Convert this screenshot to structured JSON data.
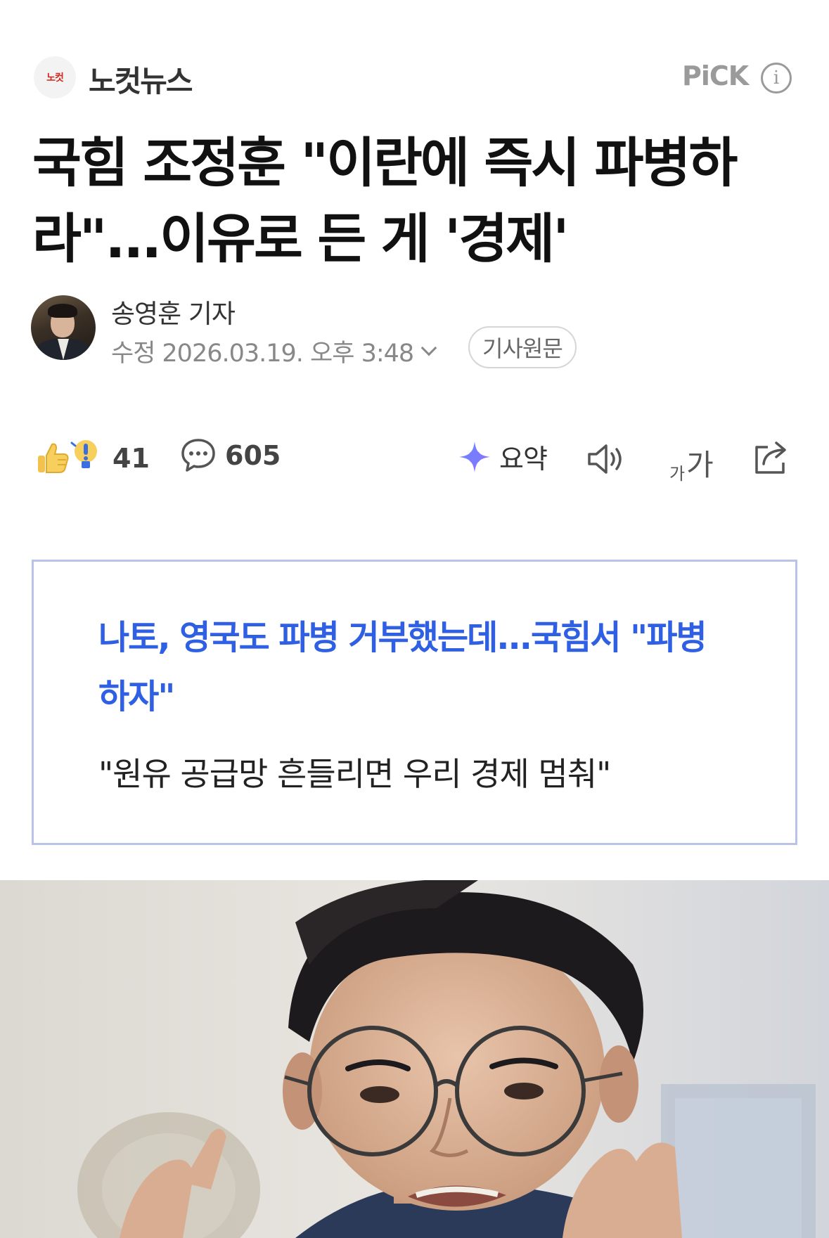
{
  "header": {
    "press_logo_text": "노컷",
    "press_name": "노컷뉴스",
    "pick_label": "PiCK",
    "info_icon": "info-icon"
  },
  "article": {
    "title": "국힘 조정훈 \"이란에 즉시 파병하라\"...이유로 든 게 '경제'",
    "reporter": "송영훈 기자",
    "modified_label": "수정",
    "modified_datetime": "2026.03.19. 오후 3:48",
    "origin_button": "기사원문"
  },
  "actions": {
    "reaction_count": "41",
    "comment_count": "605",
    "summary_label": "요약",
    "font_small": "가",
    "font_big": "가",
    "icons": [
      "reaction-icon",
      "comment-icon",
      "summary-icon",
      "speaker-icon",
      "font-size-icon",
      "share-icon"
    ]
  },
  "related": {
    "title": "나토, 영국도 파병 거부했는데...국힘서 \"파병하자\"",
    "subtitle": "\"원유 공급망 흔들리면 우리 경제 멈춰\""
  },
  "colors": {
    "accent_blue": "#2f5fe3",
    "box_border": "#b9c3e8",
    "press_red": "#d0281e",
    "muted_gray": "#888888"
  }
}
